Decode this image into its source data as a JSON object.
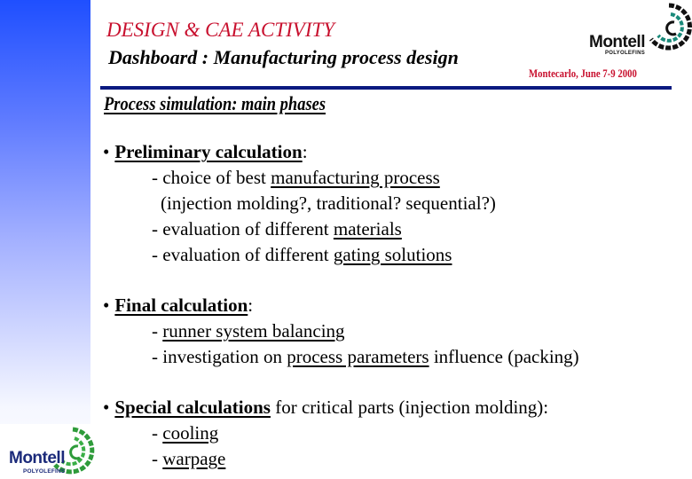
{
  "header": {
    "title": "DESIGN & CAE ACTIVITY",
    "subtitle": "Dashboard : Manufacturing process design",
    "event_date": "Montecarlo, June 7-9 2000"
  },
  "logos": {
    "top_right": {
      "name": "Montell",
      "tagline": "POLYOLEFINS"
    },
    "bottom_left": {
      "name": "Montell",
      "tagline": "POLYOLEFINS"
    }
  },
  "section": {
    "heading": "Process simulation: main phases"
  },
  "bullets": [
    {
      "title": "Preliminary calculation",
      "title_suffix": ":",
      "items": [
        {
          "prefix": "- choice of best ",
          "underlined": "manufacturing process",
          "suffix": ""
        },
        {
          "continuation": "(injection molding?, traditional? sequential?)"
        },
        {
          "prefix": "- evaluation of different ",
          "underlined": "materials",
          "suffix": ""
        },
        {
          "prefix": "- evaluation of different ",
          "underlined": "gating solutions",
          "suffix": ""
        }
      ]
    },
    {
      "title": "Final calculation",
      "title_suffix": ":",
      "items": [
        {
          "prefix": "- ",
          "underlined": "runner system balancing",
          "suffix": ""
        },
        {
          "prefix": "- investigation on ",
          "underlined": "process parameters",
          "suffix": " influence (packing)"
        }
      ]
    },
    {
      "title": "Special calculations",
      "title_suffix": " for critical parts (injection molding):",
      "items": [
        {
          "prefix": "- ",
          "underlined": "cooling",
          "suffix": ""
        },
        {
          "prefix": "- ",
          "underlined": "warpage",
          "suffix": ""
        }
      ]
    }
  ],
  "colors": {
    "title_red": "#c8102e",
    "rule_navy": "#0a1a80",
    "sidebar_top": "#1f4fff",
    "sidebar_bottom": "#f5f7ff",
    "logo_green": "#2e9b3a",
    "logo_navy": "#1b2a7a"
  }
}
